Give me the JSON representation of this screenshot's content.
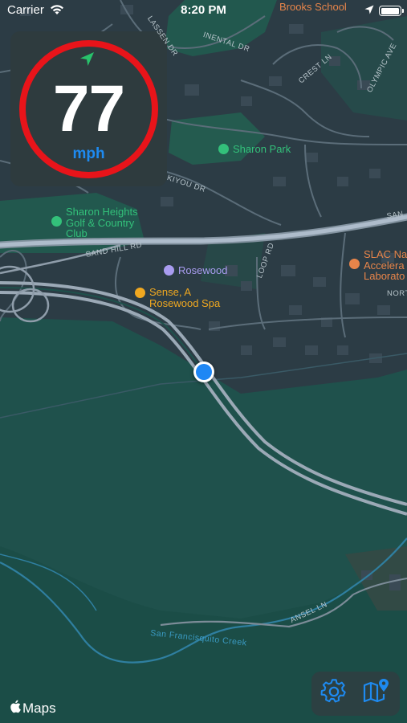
{
  "status_bar": {
    "carrier": "Carrier",
    "time": "8:20 PM",
    "battery_level": 1.0,
    "icons": [
      "wifi-icon",
      "location-arrow-icon",
      "battery-icon"
    ]
  },
  "speedometer": {
    "value": "77",
    "unit": "mph",
    "heading_icon": "location-arrow-icon",
    "ring_color": "#e8141a",
    "unit_color": "#1e8af0"
  },
  "map": {
    "pois": [
      {
        "name": "Brooks School",
        "color": "#e8854a"
      },
      {
        "name": "Sharon Park",
        "color": "#33c07a"
      },
      {
        "name": "Sharon Heights\nGolf & Country\nClub",
        "color": "#33c07a"
      },
      {
        "name": "Rosewood",
        "color": "#a99cf0"
      },
      {
        "name": "Sense, A\nRosewood Spa",
        "color": "#f0a820"
      },
      {
        "name": "SLAC Na\nAccelera\nLaborato",
        "color": "#e8854a"
      }
    ],
    "streets": [
      "LASSEN DR",
      "INENTAL DR",
      "CREST LN",
      "OLYMPIC AVE",
      "KIYOU DR",
      "SAND HILL RD",
      "SAN",
      "LOOP RD",
      "NORT",
      "ANSEL LN"
    ],
    "waterway": "San Francisquito Creek"
  },
  "controls": {
    "settings_icon": "gear-icon",
    "map_icon": "map-pin-icon",
    "accent": "#1e8af0"
  },
  "attribution": {
    "text": "Maps",
    "logo": "apple-logo-icon"
  }
}
